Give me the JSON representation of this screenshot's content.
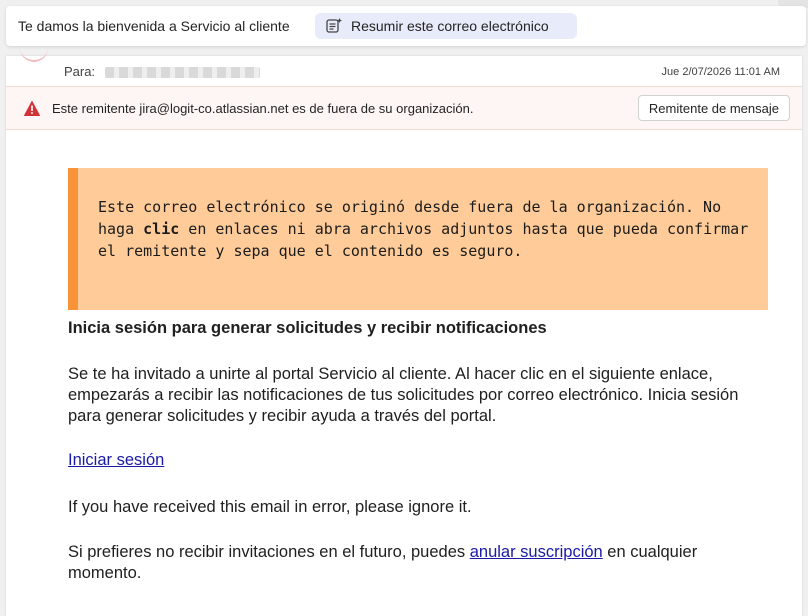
{
  "header": {
    "subject": "Te damos la bienvenida a Servicio al cliente",
    "summarize_label": "Resumir este correo electrónico",
    "summarize_icon": "summarize-sparkle-icon"
  },
  "message": {
    "to_label": "Para:",
    "date": "Jue 2/07/2026 11:01 AM"
  },
  "external_warning": {
    "icon": "warning-icon",
    "color": "#d13438",
    "text": "Este remitente jira@logit-co.atlassian.net es de fuera de su organización.",
    "button_label": "Remitente de mensaje"
  },
  "banner": {
    "text_before": "Este correo electrónico se originó desde fuera de la organización. No haga ",
    "text_bold": "clic",
    "text_after": " en enlaces ni abra archivos adjuntos hasta que pueda confirmar el remitente y sepa que el contenido es seguro.",
    "background": "#ffcc99",
    "accent": "#f7943a"
  },
  "body": {
    "heading": "Inicia sesión para generar solicitudes y recibir notificaciones",
    "paragraph": "Se te ha invitado a unirte al portal Servicio al cliente. Al hacer clic en el siguiente enlace, empezarás a recibir las notificaciones de tus solicitudes por correo electrónico. Inicia sesión para generar solicitudes y recibir ayuda a través del portal.",
    "login_link": "Iniciar sesión",
    "error_note": "If you have received this email in error, please ignore it.",
    "unsubscribe_before": "Si prefieres no recibir invitaciones en el futuro, puedes ",
    "unsubscribe_link": "anular suscripción",
    "unsubscribe_after": " en cualquier momento.",
    "link_color": "#1a1aa6"
  }
}
